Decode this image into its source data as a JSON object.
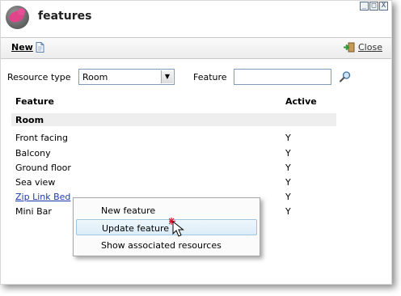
{
  "window": {
    "title": "features",
    "controls": [
      "_",
      "□",
      "X"
    ]
  },
  "toolbar": {
    "new_label": "New",
    "close_label": "Close"
  },
  "filter": {
    "resource_type_label": "Resource type",
    "resource_type_value": "Room",
    "feature_label": "Feature",
    "feature_value": ""
  },
  "table": {
    "col_feature": "Feature",
    "col_active": "Active",
    "group": "Room",
    "rows": [
      {
        "name": "Front facing",
        "active": "Y"
      },
      {
        "name": "Balcony",
        "active": "Y"
      },
      {
        "name": "Ground floor",
        "active": "Y"
      },
      {
        "name": "Sea view",
        "active": "Y"
      },
      {
        "name": "Zip Link Bed",
        "active": "Y"
      },
      {
        "name": "Mini Bar",
        "active": "Y"
      }
    ]
  },
  "context_menu": {
    "items": [
      "New feature",
      "Update feature",
      "Show associated resources"
    ]
  },
  "colors": {
    "link": "#1a36b4",
    "menu_highlight": "#dcecf7",
    "group_background": "#eeeeee"
  }
}
